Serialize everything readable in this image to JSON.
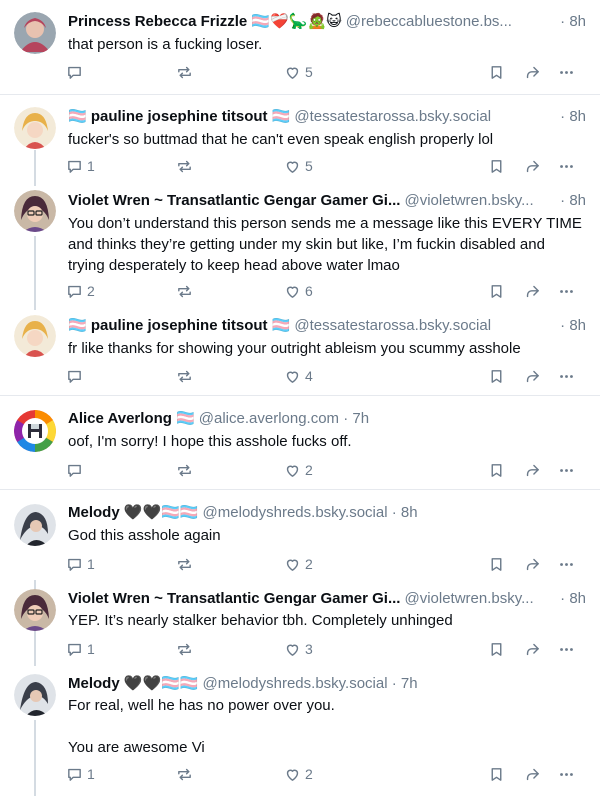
{
  "posts": [
    {
      "author_name": "Princess Rebecca Frizzle 🏳️‍⚧️❤️‍🩹🦕🧟😺",
      "handle": "@rebeccabluestone.bs...",
      "time": "8h",
      "text": "that person is a fucking loser.",
      "reply_count": "",
      "like_count": "5",
      "avatar_color": "#b5455d"
    },
    {
      "author_name": "🏳️‍⚧️ pauline josephine titsout 🏳️‍⚧️",
      "handle": "@tessatestarossa.bsky.social",
      "time": "8h",
      "text": "fucker's so buttmad that he can't even speak english properly lol",
      "reply_count": "1",
      "like_count": "5",
      "avatar_color": "#e8b14a"
    },
    {
      "author_name": "Violet Wren ~ Transatlantic Gengar Gamer Gi...",
      "handle": "@violetwren.bsky...",
      "time": "8h",
      "text": "You don’t understand this person sends me a message like this EVERY TIME and thinks they’re getting under my skin but like, I’m fuckin disabled and trying desperately to keep head above water lmao",
      "reply_count": "2",
      "like_count": "6",
      "avatar_color": "#6b4a8a"
    },
    {
      "author_name": "🏳️‍⚧️ pauline josephine titsout 🏳️‍⚧️",
      "handle": "@tessatestarossa.bsky.social",
      "time": "8h",
      "text": "fr like thanks for showing your outright ableism you scummy asshole",
      "reply_count": "",
      "like_count": "4",
      "avatar_color": "#e8b14a"
    },
    {
      "author_name": "Alice Averlong 🏳️‍⚧️",
      "handle": "@alice.averlong.com",
      "time": "7h",
      "text": "oof, I'm sorry! I hope this asshole fucks off.",
      "reply_count": "",
      "like_count": "2",
      "avatar_color": "#2d2d3a"
    },
    {
      "author_name": "Melody 🖤🖤🏳️‍⚧️🏳️‍⚧️",
      "handle": "@melodyshreds.bsky.social",
      "time": "8h",
      "text": "God this asshole again",
      "reply_count": "1",
      "like_count": "2",
      "avatar_color": "#3a3f4a"
    },
    {
      "author_name": "Violet Wren ~ Transatlantic Gengar Gamer Gi...",
      "handle": "@violetwren.bsky...",
      "time": "8h",
      "text": "YEP. It’s nearly stalker behavior tbh. Completely unhinged",
      "reply_count": "1",
      "like_count": "3",
      "avatar_color": "#6b4a8a"
    },
    {
      "author_name": "Melody 🖤🖤🏳️‍⚧️🏳️‍⚧️",
      "handle": "@melodyshreds.bsky.social",
      "time": "7h",
      "text": "For real, well he has no power over you.\n\nYou are awesome Vi",
      "reply_count": "1",
      "like_count": "2",
      "avatar_color": "#3a3f4a"
    }
  ],
  "colors": {
    "text": "#0b0f14",
    "muted": "#6b7a8a",
    "divider": "#e6e9ee",
    "thread_line": "#d4dbe2"
  }
}
